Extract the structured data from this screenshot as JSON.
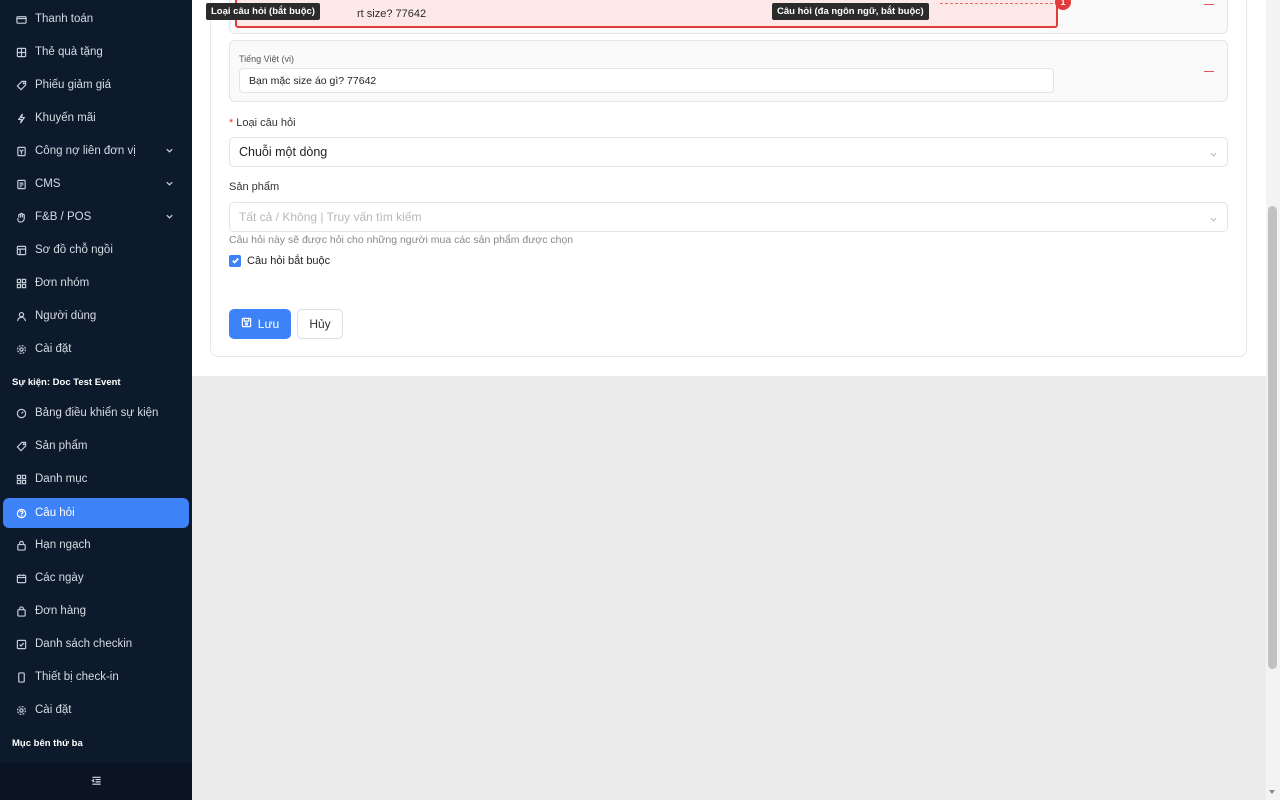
{
  "sidebar": {
    "items": [
      {
        "label": "Thanh toán",
        "icon": "wallet-icon"
      },
      {
        "label": "Thẻ quà tặng",
        "icon": "gift-card-icon"
      },
      {
        "label": "Phiếu giảm giá",
        "icon": "tag-icon"
      },
      {
        "label": "Khuyến mãi",
        "icon": "lightning-icon"
      },
      {
        "label": "Công nợ liên đơn vị",
        "icon": "ledger-icon"
      },
      {
        "label": "CMS",
        "icon": "document-icon"
      },
      {
        "label": "F&B / POS",
        "icon": "hand-icon"
      },
      {
        "label": "Sơ đồ chỗ ngồi",
        "icon": "layout-icon"
      },
      {
        "label": "Đơn nhóm",
        "icon": "grid-icon"
      },
      {
        "label": "Người dùng",
        "icon": "user-icon"
      },
      {
        "label": "Cài đặt",
        "icon": "gear-icon"
      }
    ],
    "event_section_title": "Sự kiện: Doc Test Event",
    "event_items": [
      {
        "label": "Bảng điều khiển sự kiện",
        "icon": "dashboard-icon"
      },
      {
        "label": "Sản phẩm",
        "icon": "tag-icon"
      },
      {
        "label": "Danh mục",
        "icon": "grid-icon"
      },
      {
        "label": "Câu hỏi",
        "icon": "question-icon"
      },
      {
        "label": "Hạn ngạch",
        "icon": "lock-icon"
      },
      {
        "label": "Các ngày",
        "icon": "calendar-icon"
      },
      {
        "label": "Đơn hàng",
        "icon": "bag-icon"
      },
      {
        "label": "Danh sách checkin",
        "icon": "checklist-icon"
      },
      {
        "label": "Thiết bị check-in",
        "icon": "phone-icon"
      },
      {
        "label": "Cài đặt",
        "icon": "gear-icon"
      }
    ],
    "third_party_title": "Mục bên thứ ba",
    "footer_icon": "menu-fold-icon"
  },
  "form": {
    "top_input_fragment": "rt size? 77642",
    "error_count": "1",
    "tooltip_left": "Loại câu hỏi (bắt buộc)",
    "tooltip_right": "Câu hỏi (đa ngôn ngữ, bắt buộc)",
    "vi_label": "Tiếng Việt (vi)",
    "vi_value": "Bạn mặc size áo gì? 77642",
    "question_type_label": "Loại câu hỏi",
    "question_type_value": "Chuỗi một dòng",
    "products_label": "Sản phẩm",
    "products_placeholder": "Tất cả / Không | Truy vấn tìm kiếm",
    "products_help": "Câu hỏi này sẽ được hỏi cho những người mua các sản phẩm được chọn",
    "required_checkbox_label": "Câu hỏi bắt buộc",
    "required_checked": true,
    "save_label": "Lưu",
    "cancel_label": "Hủy"
  },
  "colors": {
    "sidebar_bg": "#0d1a2b",
    "accent": "#3d82f6",
    "error": "#e33b3b"
  }
}
